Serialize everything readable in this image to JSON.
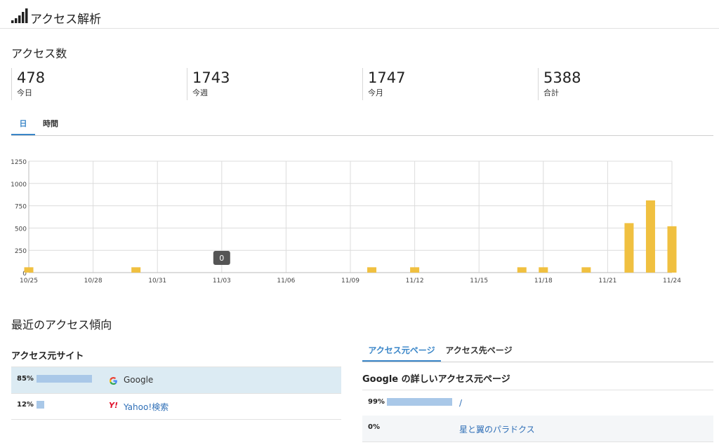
{
  "header": {
    "title": "アクセス解析"
  },
  "access": {
    "title": "アクセス数",
    "stats": [
      {
        "value": "478",
        "label": "今日"
      },
      {
        "value": "1743",
        "label": "今週"
      },
      {
        "value": "1747",
        "label": "今月"
      },
      {
        "value": "5388",
        "label": "合計"
      }
    ]
  },
  "tabs1": [
    {
      "label": "日",
      "active": true
    },
    {
      "label": "時間",
      "active": false
    }
  ],
  "chart_data": {
    "type": "bar",
    "ylim": [
      0,
      1250
    ],
    "yticks": [
      "0",
      "250",
      "500",
      "750",
      "1000",
      "1250"
    ],
    "xticks": [
      "10/25",
      "10/28",
      "10/31",
      "11/03",
      "11/06",
      "11/09",
      "11/12",
      "11/15",
      "11/18",
      "11/21",
      "11/24"
    ],
    "x": [
      "10/25",
      "10/26",
      "10/27",
      "10/28",
      "10/29",
      "10/30",
      "10/31",
      "11/01",
      "11/02",
      "11/03",
      "11/04",
      "11/05",
      "11/06",
      "11/07",
      "11/08",
      "11/09",
      "11/10",
      "11/11",
      "11/12",
      "11/13",
      "11/14",
      "11/15",
      "11/16",
      "11/17",
      "11/18",
      "11/19",
      "11/20",
      "11/21",
      "11/22",
      "11/23",
      "11/24"
    ],
    "values": [
      60,
      0,
      0,
      0,
      0,
      60,
      0,
      0,
      0,
      0,
      0,
      0,
      0,
      0,
      0,
      0,
      60,
      0,
      60,
      0,
      0,
      0,
      0,
      60,
      60,
      0,
      60,
      0,
      555,
      810,
      520
    ],
    "tooltip": "0",
    "bar_color": "#f0c040",
    "grid": true
  },
  "trends": {
    "title": "最近のアクセス傾向",
    "sources_title": "アクセス元サイト",
    "sources": [
      {
        "pct": "85%",
        "ratio": 0.85,
        "name": "Google",
        "icon": "google-icon"
      },
      {
        "pct": "12%",
        "ratio": 0.12,
        "name": "Yahoo!検索",
        "icon": "yahoo-icon"
      }
    ],
    "page_tabs": [
      {
        "label": "アクセス元ページ",
        "active": true
      },
      {
        "label": "アクセス先ページ",
        "active": false
      }
    ],
    "detail_title": "Google の詳しいアクセス元ページ",
    "pages": [
      {
        "pct": "99%",
        "ratio": 0.99,
        "name": "/"
      },
      {
        "pct": "0%",
        "ratio": 0.0,
        "name": "星と翼のパラドクス"
      }
    ]
  },
  "colors": {
    "accent": "#3a86c8",
    "bar": "#f0c040",
    "source_bar": "#a9c8e8",
    "highlight": "#dcebf3"
  }
}
